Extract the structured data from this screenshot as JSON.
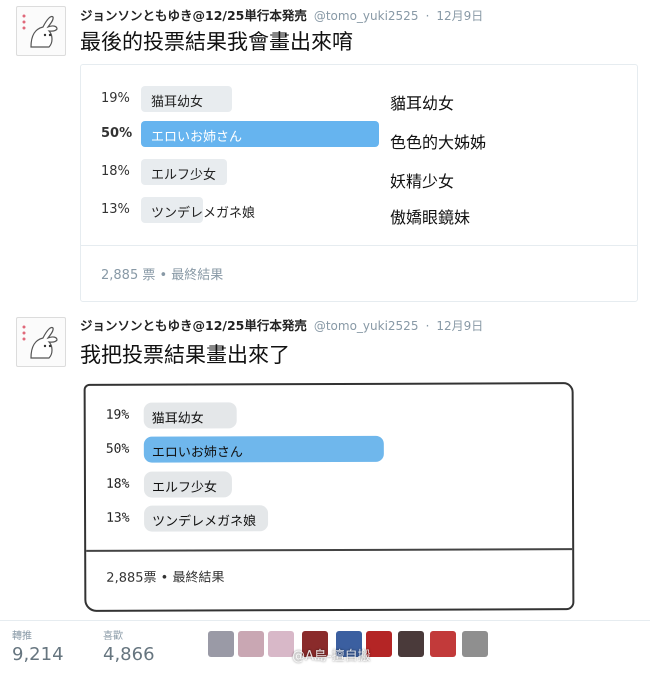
{
  "tweet1": {
    "author_name": "ジョンソンともゆき@12/25単行本発売",
    "handle": "@tomo_yuki2525",
    "date": "12月9日",
    "text": "最後的投票結果我會畫出來唷",
    "poll": {
      "options": [
        {
          "percent_label": "19%",
          "value": 19,
          "label": "猫耳幼女",
          "translation": "貓耳幼女"
        },
        {
          "percent_label": "50%",
          "value": 50,
          "label": "エロいお姉さん",
          "translation": "色色的大姊姊",
          "winner": true
        },
        {
          "percent_label": "18%",
          "value": 18,
          "label": "エルフ少女",
          "translation": "妖精少女"
        },
        {
          "percent_label": "13%",
          "value": 13,
          "label": "ツンデレメガネ娘",
          "translation": "傲嬌眼鏡妹"
        }
      ],
      "footer": "2,885 票 • 最終結果"
    }
  },
  "tweet2": {
    "author_name": "ジョンソンともゆき@12/25単行本発売",
    "handle": "@tomo_yuki2525",
    "date": "12月9日",
    "text": "我把投票結果畫出來了",
    "drawn_poll": {
      "options": [
        {
          "percent_label": "19%",
          "value": 19,
          "label": "猫耳幼女"
        },
        {
          "percent_label": "50%",
          "value": 50,
          "label": "エロいお姉さん",
          "winner": true
        },
        {
          "percent_label": "18%",
          "value": 18,
          "label": "エルフ少女"
        },
        {
          "percent_label": "13%",
          "value": 13,
          "label": "ツンデレメガネ娘"
        }
      ],
      "footer": "2,885票 • 最終結果"
    }
  },
  "stats": {
    "retweets_label": "轉推",
    "retweets": "9,214",
    "likes_label": "喜歡",
    "likes": "4,866",
    "watermark": "@A島-擅自搬"
  },
  "colors": {
    "winner_bar": "#66b4ef",
    "bar": "#e8ecef",
    "muted": "#8899a6"
  }
}
